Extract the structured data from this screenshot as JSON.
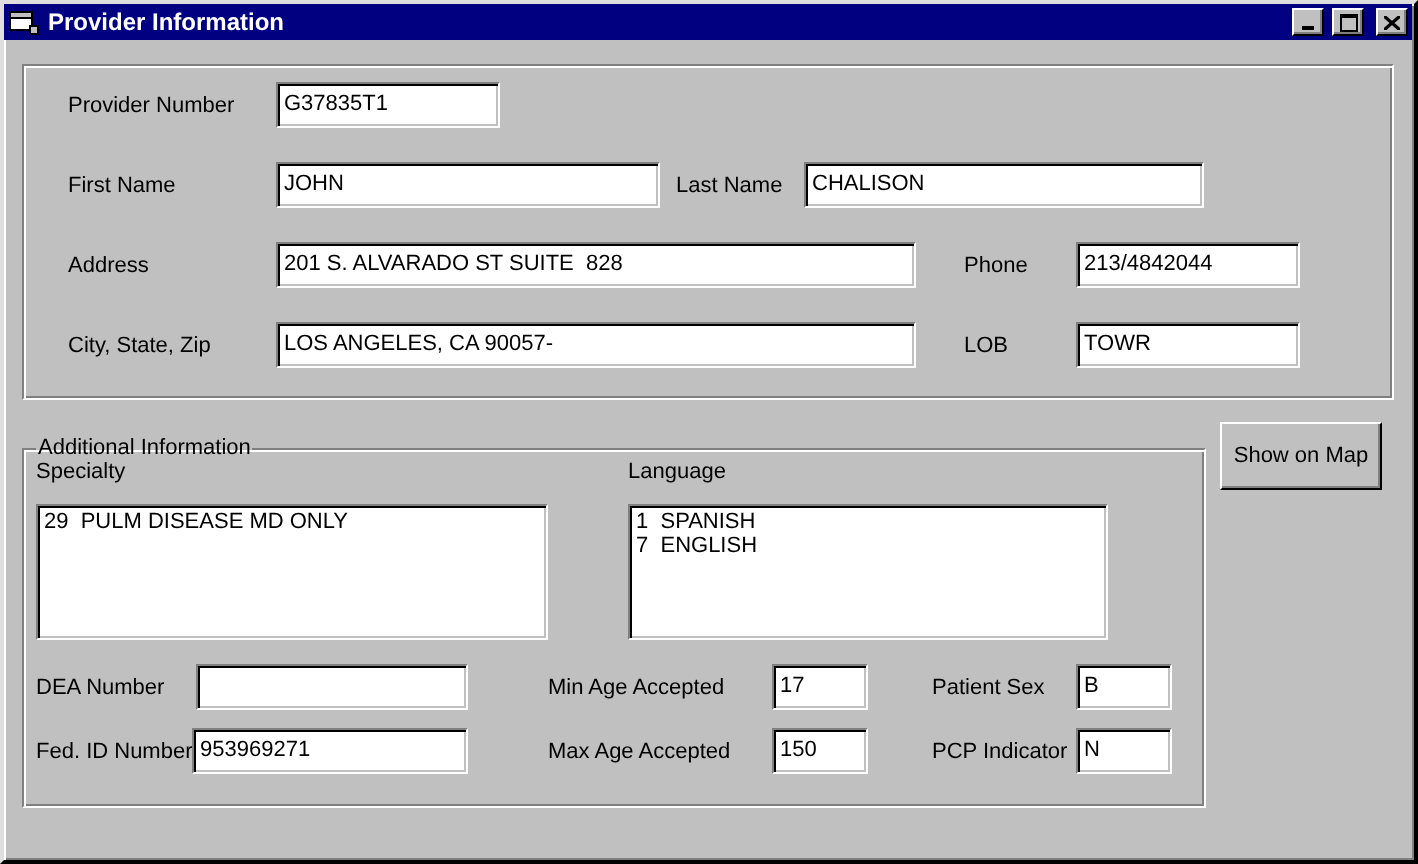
{
  "window": {
    "title": "Provider Information"
  },
  "provider_section": {
    "rows": [
      {
        "fields": [
          {
            "label": "Provider Number",
            "value": "G37835T1"
          }
        ]
      },
      {
        "fields": [
          {
            "label": "First Name",
            "value": "JOHN"
          },
          {
            "label": "Last Name",
            "value": "CHALISON"
          }
        ]
      },
      {
        "fields": [
          {
            "label": "Address",
            "value": "201 S. ALVARADO ST SUITE  828"
          },
          {
            "label": "Phone",
            "value": "213/4842044"
          }
        ]
      },
      {
        "fields": [
          {
            "label": "City, State, Zip",
            "value": "LOS ANGELES, CA 90057-"
          },
          {
            "label": "LOB",
            "value": "TOWR"
          }
        ]
      }
    ]
  },
  "additional_information": {
    "title": "Additional Information",
    "lists": [
      {
        "label": "Specialty",
        "items": [
          "29  PULM DISEASE MD ONLY"
        ]
      },
      {
        "label": "Language",
        "items": [
          "1  SPANISH",
          "7  ENGLISH"
        ]
      }
    ],
    "rows": [
      {
        "fields": [
          {
            "label": "DEA Number"
          },
          {
            "label": "Min Age Accepted",
            "value": "17"
          },
          {
            "label": "Patient Sex",
            "value": "B"
          }
        ]
      },
      {
        "fields": [
          {
            "label": "Fed. ID Number",
            "value": "953969271"
          },
          {
            "label": "Max Age Accepted",
            "value": "150"
          },
          {
            "label": "PCP Indicator",
            "value": "N"
          }
        ]
      }
    ]
  },
  "buttons": [
    {
      "label": "Show on Map"
    }
  ]
}
